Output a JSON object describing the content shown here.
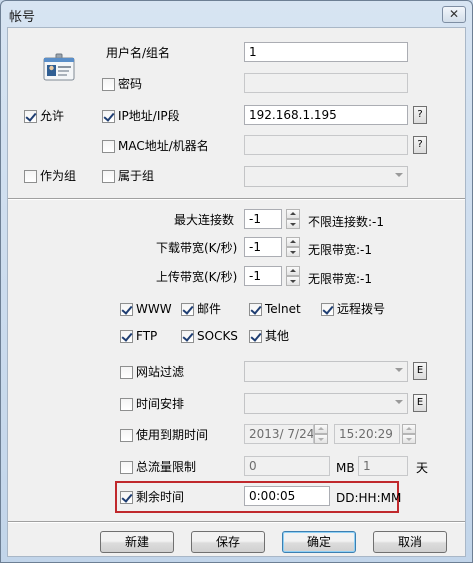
{
  "window": {
    "title": "帐号",
    "close_glyph": "✕"
  },
  "account": {
    "allow_label": "允许",
    "allow_checked": true,
    "as_group_label": "作为组",
    "as_group_checked": false,
    "username_label": "用户名/组名",
    "username_value": "1",
    "password_label": "密码",
    "password_checked": false,
    "ip_label": "IP地址/IP段",
    "ip_checked": true,
    "ip_value": "192.168.1.195",
    "ip_help": "?",
    "mac_label": "MAC地址/机器名",
    "mac_checked": false,
    "mac_help": "?",
    "belongs_label": "属于组",
    "belongs_checked": false
  },
  "limits": {
    "max_conn_label": "最大连接数",
    "max_conn_value": "-1",
    "max_conn_hint": "不限连接数:-1",
    "download_label": "下载带宽(K/秒)",
    "download_value": "-1",
    "download_hint": "无限带宽:-1",
    "upload_label": "上传带宽(K/秒)",
    "upload_value": "-1",
    "upload_hint": "无限带宽:-1"
  },
  "services": [
    {
      "label": "WWW",
      "checked": true
    },
    {
      "label": "邮件",
      "checked": true
    },
    {
      "label": "Telnet",
      "checked": true
    },
    {
      "label": "远程拨号",
      "checked": true
    },
    {
      "label": "FTP",
      "checked": true
    },
    {
      "label": "SOCKS",
      "checked": true
    },
    {
      "label": "其他",
      "checked": true
    }
  ],
  "options": {
    "site_filter_label": "网站过滤",
    "site_filter_checked": false,
    "site_filter_btn": "E",
    "schedule_label": "时间安排",
    "schedule_checked": false,
    "schedule_btn": "E",
    "expiry_label": "使用到期时间",
    "expiry_checked": false,
    "expiry_date": "2013/ 7/24",
    "expiry_time": "15:20:29",
    "traffic_label": "总流量限制",
    "traffic_checked": false,
    "traffic_value": "0",
    "traffic_unit": "MB",
    "traffic_days": "1",
    "traffic_days_unit": "天",
    "remaining_label": "剩余时间",
    "remaining_checked": true,
    "remaining_value": "0:00:05",
    "remaining_format": "DD:HH:MM"
  },
  "buttons": {
    "new": "新建",
    "save": "保存",
    "ok": "确定",
    "cancel": "取消"
  },
  "colors": {
    "highlight": "#c0282c",
    "titlebar": "#c9d9eb"
  }
}
